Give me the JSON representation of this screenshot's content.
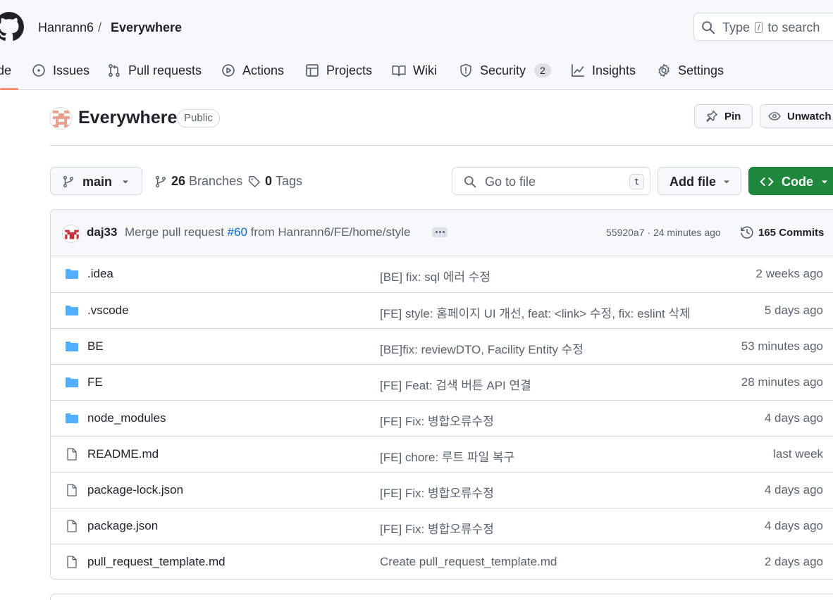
{
  "header": {
    "owner": "Hanrann6",
    "separator": "/",
    "repo": "Everywhere",
    "search_placeholder_before": "Type",
    "search_key": "/",
    "search_placeholder_after": "to search"
  },
  "tabs": [
    {
      "label": "de",
      "icon": "code-icon",
      "active": true
    },
    {
      "label": "Issues",
      "icon": "issue-icon"
    },
    {
      "label": "Pull requests",
      "icon": "pull-request-icon"
    },
    {
      "label": "Actions",
      "icon": "play-icon"
    },
    {
      "label": "Projects",
      "icon": "table-icon"
    },
    {
      "label": "Wiki",
      "icon": "book-icon"
    },
    {
      "label": "Security",
      "icon": "shield-icon",
      "count": "2"
    },
    {
      "label": "Insights",
      "icon": "graph-icon"
    },
    {
      "label": "Settings",
      "icon": "gear-icon"
    }
  ],
  "repo_header": {
    "title": "Everywhere",
    "visibility": "Public",
    "pin_label": "Pin",
    "unwatch_label": "Unwatch"
  },
  "toolbar": {
    "branch": "main",
    "branches_count": "26",
    "branches_label": "Branches",
    "tags_count": "0",
    "tags_label": "Tags",
    "goto_placeholder": "Go to file",
    "goto_key": "t",
    "add_file_label": "Add file",
    "code_label": "Code"
  },
  "commit": {
    "author": "daj33",
    "message_before": "Merge pull request",
    "pr_link": "#60",
    "message_after": "from Hanrann6/FE/home/style",
    "sha_time": "55920a7 · 24 minutes ago",
    "commits_count": "165 Commits"
  },
  "files": [
    {
      "type": "folder",
      "name": ".idea",
      "message": "[BE] fix: sql 에러 수정",
      "time": "2 weeks ago"
    },
    {
      "type": "folder",
      "name": ".vscode",
      "message": "[FE] style: 홈페이지 UI 개선, feat: <link> 수정, fix: eslint 삭제",
      "time": "5 days ago"
    },
    {
      "type": "folder",
      "name": "BE",
      "message": "[BE]fix: reviewDTO, Facility Entity 수정",
      "time": "53 minutes ago"
    },
    {
      "type": "folder",
      "name": "FE",
      "message": "[FE] Feat: 검색 버튼 API 연결",
      "time": "28 minutes ago"
    },
    {
      "type": "folder",
      "name": "node_modules",
      "message": "[FE] Fix: 병합오류수정",
      "time": "4 days ago"
    },
    {
      "type": "file",
      "name": "README.md",
      "message": "[FE] chore: 루트 파일 복구",
      "time": "last week"
    },
    {
      "type": "file",
      "name": "package-lock.json",
      "message": "[FE] Fix: 병합오류수정",
      "time": "4 days ago"
    },
    {
      "type": "file",
      "name": "package.json",
      "message": "[FE] Fix: 병합오류수정",
      "time": "4 days ago"
    },
    {
      "type": "file",
      "name": "pull_request_template.md",
      "message": "Create pull_request_template.md",
      "time": "2 days ago"
    }
  ],
  "colors": {
    "folder": "#54aeff",
    "primary_button": "#1f883d",
    "link": "#0969da",
    "tab_underline": "#fd8c73"
  }
}
